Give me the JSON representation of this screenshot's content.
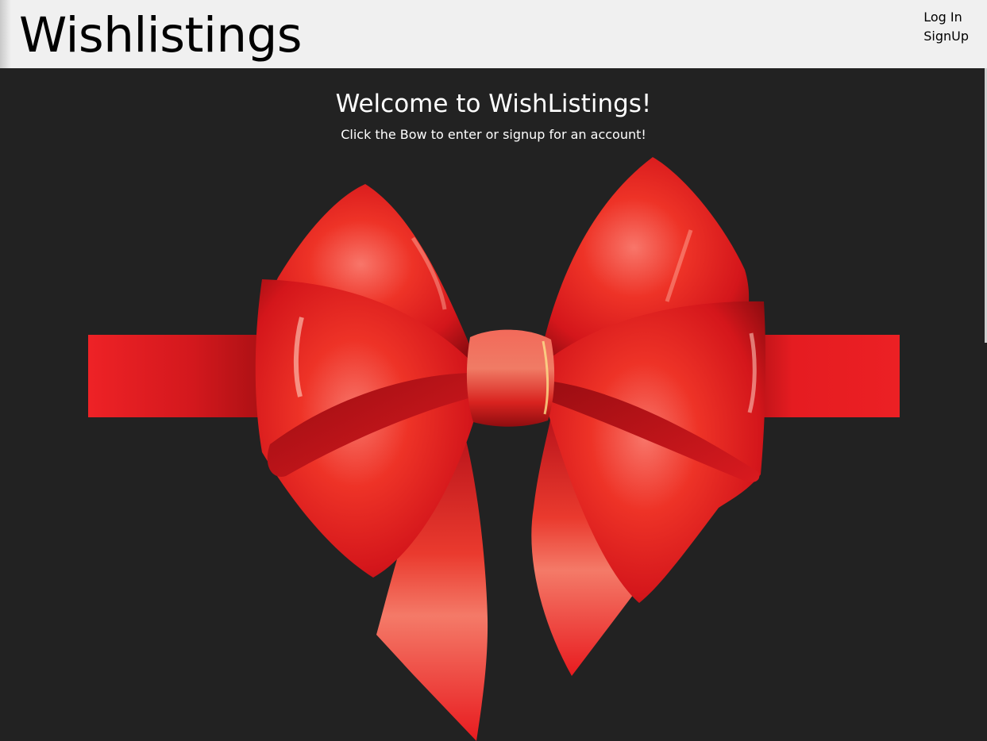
{
  "header": {
    "brand": "Wishlistings",
    "nav": {
      "login_label": "Log In",
      "signup_label": "SignUp"
    }
  },
  "main": {
    "title": "Welcome to WishListings!",
    "subtitle": "Click the Bow to enter or signup for an account!"
  },
  "colors": {
    "header_bg": "#f0f0f0",
    "page_bg": "#222222",
    "ribbon_red": "#e8191f",
    "text_light": "#ffffff",
    "text_dark": "#000000"
  },
  "image": {
    "name": "red-gift-bow"
  }
}
